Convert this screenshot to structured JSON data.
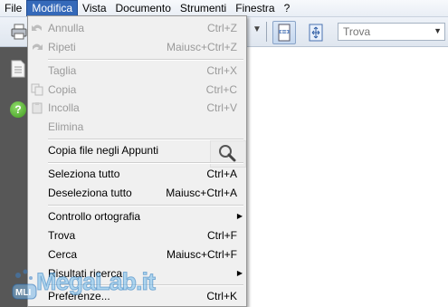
{
  "menubar": {
    "items": [
      "File",
      "Modifica",
      "Vista",
      "Documento",
      "Strumenti",
      "Finestra",
      "?"
    ]
  },
  "toolbar": {
    "find_placeholder": "Trova"
  },
  "edit_menu": {
    "undo": {
      "label": "Annulla",
      "shortcut": "Ctrl+Z"
    },
    "redo": {
      "label": "Ripeti",
      "shortcut": "Maiusc+Ctrl+Z"
    },
    "cut": {
      "label": "Taglia",
      "shortcut": "Ctrl+X"
    },
    "copy": {
      "label": "Copia",
      "shortcut": "Ctrl+C"
    },
    "paste": {
      "label": "Incolla",
      "shortcut": "Ctrl+V"
    },
    "delete": {
      "label": "Elimina"
    },
    "copy_file": {
      "label": "Copia file negli Appunti"
    },
    "select_all": {
      "label": "Seleziona tutto",
      "shortcut": "Ctrl+A"
    },
    "deselect_all": {
      "label": "Deseleziona tutto",
      "shortcut": "Maiusc+Ctrl+A"
    },
    "spell_check": {
      "label": "Controllo ortografia"
    },
    "find": {
      "label": "Trova",
      "shortcut": "Ctrl+F"
    },
    "search": {
      "label": "Cerca",
      "shortcut": "Maiusc+Ctrl+F"
    },
    "search_results": {
      "label": "Risultati ricerca"
    },
    "preferences": {
      "label": "Preferenze...",
      "shortcut": "Ctrl+K"
    }
  },
  "watermark": {
    "text": "MegaLab.it",
    "badge": "MLI"
  }
}
